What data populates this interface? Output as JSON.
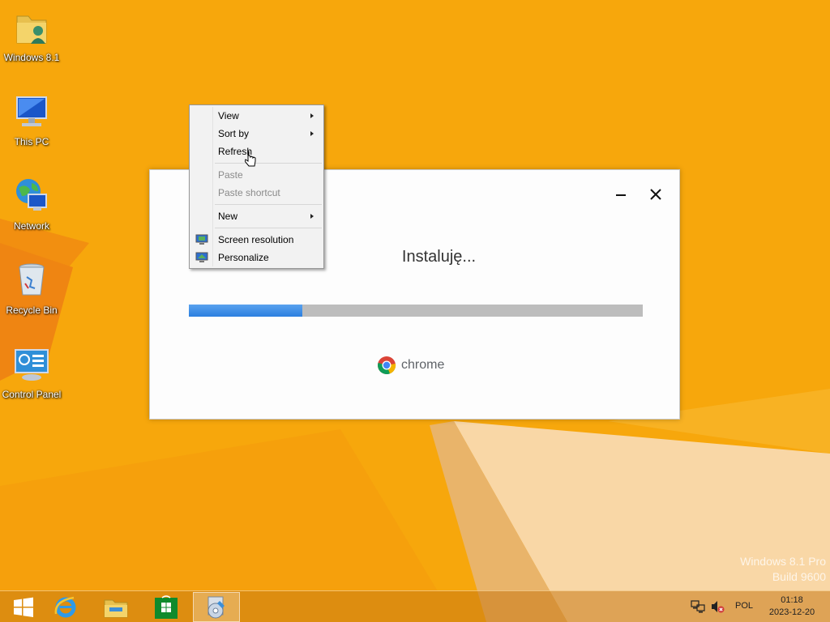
{
  "desktop": {
    "icons": [
      {
        "label": "Windows 8.1",
        "icon": "user-folder-icon"
      },
      {
        "label": "This PC",
        "icon": "computer-icon"
      },
      {
        "label": "Network",
        "icon": "network-globe-icon"
      },
      {
        "label": "Recycle Bin",
        "icon": "recycle-bin-icon"
      },
      {
        "label": "Control Panel",
        "icon": "control-panel-icon"
      }
    ],
    "watermark": {
      "line1": "Windows 8.1 Pro",
      "line2": "Build 9600"
    }
  },
  "installer": {
    "title": "Instaluję...",
    "progress": 0.25,
    "brand": "chrome",
    "minimize_icon": "minimize-icon",
    "close_icon": "close-icon",
    "colors": {
      "progress_fill": "#2b7fe0",
      "progress_track": "#bdbdbd"
    }
  },
  "context_menu": {
    "items": [
      {
        "label": "View",
        "submenu": true,
        "enabled": true
      },
      {
        "label": "Sort by",
        "submenu": true,
        "enabled": true
      },
      {
        "label": "Refresh",
        "submenu": false,
        "enabled": true
      },
      {
        "label": "Paste",
        "submenu": false,
        "enabled": false
      },
      {
        "label": "Paste shortcut",
        "submenu": false,
        "enabled": false
      },
      {
        "label": "New",
        "submenu": true,
        "enabled": true
      },
      {
        "label": "Screen resolution",
        "submenu": false,
        "enabled": true,
        "icon": "screen-resolution-icon"
      },
      {
        "label": "Personalize",
        "submenu": false,
        "enabled": true,
        "icon": "personalize-icon"
      }
    ]
  },
  "taskbar": {
    "buttons": [
      {
        "icon": "start-windows-icon"
      },
      {
        "icon": "internet-explorer-icon"
      },
      {
        "icon": "file-explorer-icon"
      },
      {
        "icon": "store-icon"
      },
      {
        "icon": "installer-app-icon",
        "active": true
      }
    ],
    "tray": {
      "network_icon": "network-tray-icon",
      "volume_icon": "volume-muted-icon",
      "language": "POL",
      "time": "01:18",
      "date": "2023-12-20"
    }
  },
  "colors": {
    "accent": "#f7a70c",
    "taskbar": "#c8781a"
  }
}
